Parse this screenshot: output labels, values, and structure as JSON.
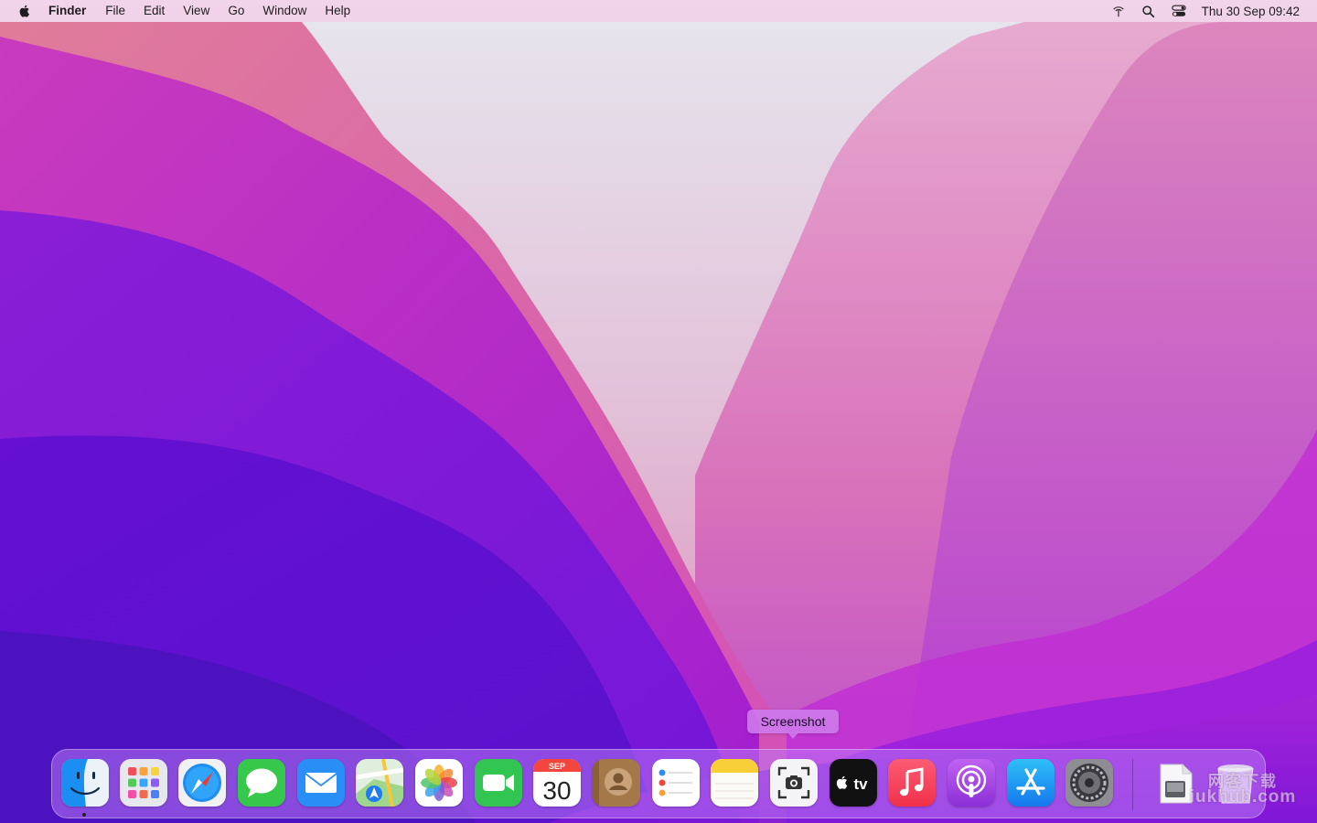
{
  "menubar": {
    "apple_icon": "apple-logo-icon",
    "app_name": "Finder",
    "items": [
      "File",
      "Edit",
      "View",
      "Go",
      "Window",
      "Help"
    ],
    "status_icons": [
      "airdrop-icon",
      "spotlight-search-icon",
      "control-center-icon"
    ],
    "clock": "Thu 30 Sep  09:42"
  },
  "tooltip": {
    "text": "Screenshot"
  },
  "dock": {
    "apps": [
      {
        "name": "Finder",
        "icon": "finder-icon",
        "running": true
      },
      {
        "name": "Launchpad",
        "icon": "launchpad-icon"
      },
      {
        "name": "Safari",
        "icon": "safari-icon"
      },
      {
        "name": "Messages",
        "icon": "messages-icon"
      },
      {
        "name": "Mail",
        "icon": "mail-icon"
      },
      {
        "name": "Maps",
        "icon": "maps-icon"
      },
      {
        "name": "Photos",
        "icon": "photos-icon"
      },
      {
        "name": "FaceTime",
        "icon": "facetime-icon"
      },
      {
        "name": "Calendar",
        "icon": "calendar-icon",
        "month": "SEP",
        "day": "30"
      },
      {
        "name": "Contacts",
        "icon": "contacts-icon"
      },
      {
        "name": "Reminders",
        "icon": "reminders-icon"
      },
      {
        "name": "Notes",
        "icon": "notes-icon"
      },
      {
        "name": "Screenshot",
        "icon": "screenshot-icon"
      },
      {
        "name": "TV",
        "icon": "apple-tv-icon",
        "label": "tv"
      },
      {
        "name": "Music",
        "icon": "music-icon"
      },
      {
        "name": "Podcasts",
        "icon": "podcasts-icon"
      },
      {
        "name": "App Store",
        "icon": "app-store-icon"
      },
      {
        "name": "System Preferences",
        "icon": "system-preferences-icon"
      }
    ],
    "stack": {
      "icon": "downloads-stack-icon"
    },
    "trash": {
      "icon": "trash-icon"
    }
  },
  "watermark": {
    "line1": "网客下载",
    "line2": "iukhub.com"
  },
  "colors": {
    "menubar": "#f2d0e8",
    "dock": "#b978f5",
    "tooltip": "#cd78eb"
  }
}
